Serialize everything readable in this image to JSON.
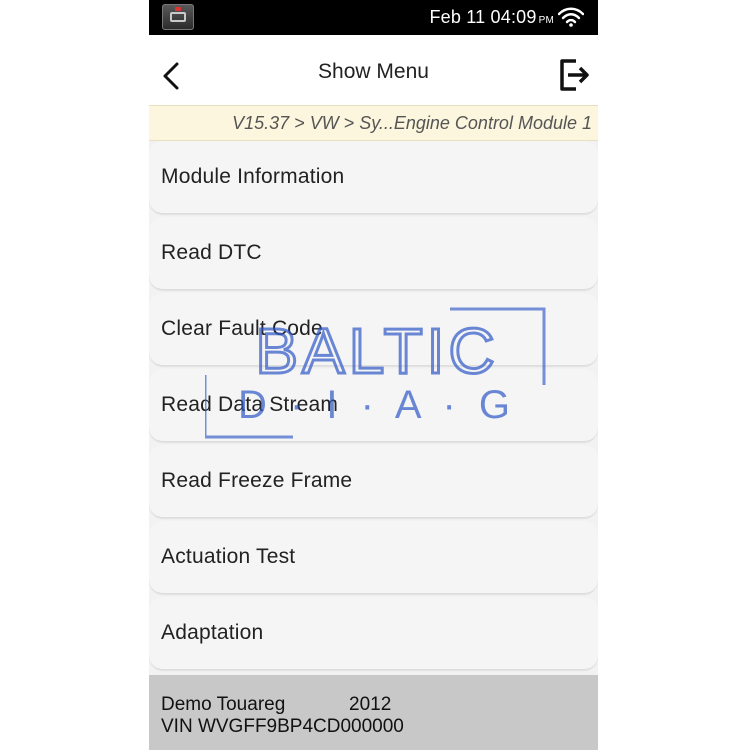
{
  "status_bar": {
    "date": "Feb 11",
    "time": "04:09",
    "ampm": "PM",
    "app_icon": "diagnostic-app-icon",
    "wifi_icon": "wifi-icon"
  },
  "header": {
    "title": "Show Menu",
    "back_icon": "back-arrow-icon",
    "exit_icon": "exit-icon"
  },
  "breadcrumb": "V15.37 > VW > Sy...Engine Control Module 1",
  "menu": {
    "items": [
      {
        "label": "Module Information"
      },
      {
        "label": "Read DTC"
      },
      {
        "label": "Clear Fault Code"
      },
      {
        "label": "Read Data Stream"
      },
      {
        "label": "Read Freeze Frame"
      },
      {
        "label": "Actuation Test"
      },
      {
        "label": "Adaptation"
      }
    ]
  },
  "footer": {
    "model": "Demo Touareg",
    "year": "2012",
    "vin": "VIN WVGFF9BP4CD000000"
  },
  "watermark": {
    "line1": "BALTIC",
    "line2": "D · I · A · G",
    "color": "#2e57c8"
  },
  "colors": {
    "status_bar_bg": "#000000",
    "header_bg": "#ffffff",
    "breadcrumb_bg": "#fbf6dd",
    "list_bg": "#f2f2f2",
    "footer_bg": "#c8c8c8"
  }
}
